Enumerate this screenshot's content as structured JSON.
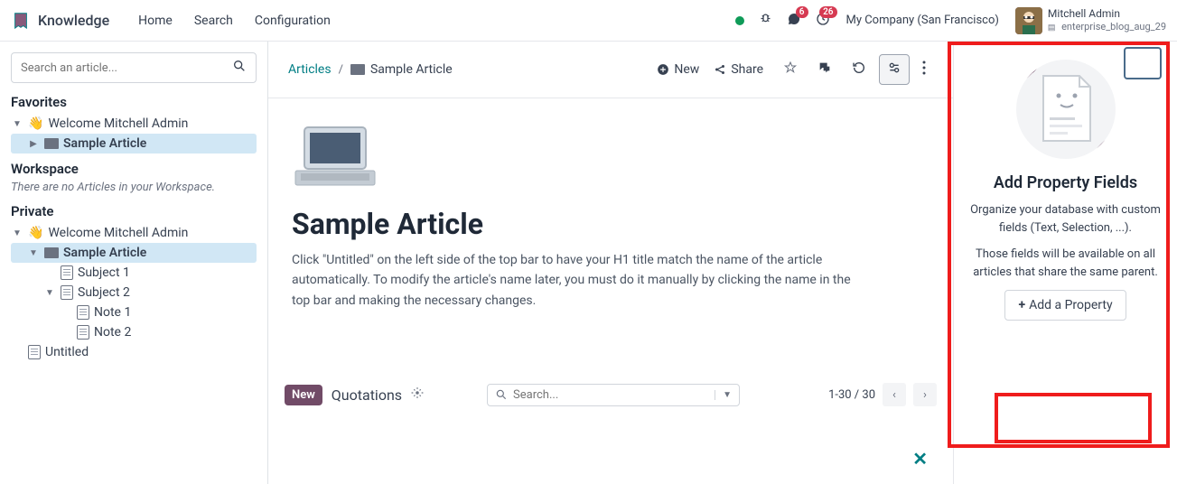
{
  "app": {
    "name": "Knowledge"
  },
  "nav": {
    "home": "Home",
    "search": "Search",
    "configuration": "Configuration"
  },
  "header": {
    "chat_badge": "6",
    "activity_badge": "26",
    "company": "My Company (San Francisco)",
    "user_name": "Mitchell Admin",
    "user_sub": "enterprise_blog_aug_29"
  },
  "sidebar": {
    "search_placeholder": "Search an article...",
    "favorites": {
      "title": "Favorites",
      "welcome": "Welcome Mitchell Admin",
      "sample": "Sample Article"
    },
    "workspace": {
      "title": "Workspace",
      "empty": "There are no Articles in your Workspace."
    },
    "private": {
      "title": "Private",
      "welcome": "Welcome Mitchell Admin",
      "sample": "Sample Article",
      "subject1": "Subject 1",
      "subject2": "Subject 2",
      "note1": "Note 1",
      "note2": "Note 2",
      "untitled": "Untitled"
    }
  },
  "breadcrumb": {
    "root": "Articles",
    "current": "Sample Article"
  },
  "toolbar": {
    "new": "New",
    "share": "Share"
  },
  "article": {
    "title": "Sample Article",
    "body": "Click \"Untitled\" on the left side of the top bar to have your H1 title match the name of the article automatically. To modify the article's name later, you must do it manually by clicking the name in the top bar and making the necessary changes."
  },
  "dataview": {
    "new": "New",
    "label": "Quotations",
    "search_placeholder": "Search...",
    "pager": "1-30 / 30"
  },
  "panel": {
    "title": "Add Property Fields",
    "text1": "Organize your database with custom fields (Text, Selection, ...).",
    "text2": "Those fields will be available on all articles that share the same parent.",
    "button": "Add a Property"
  }
}
